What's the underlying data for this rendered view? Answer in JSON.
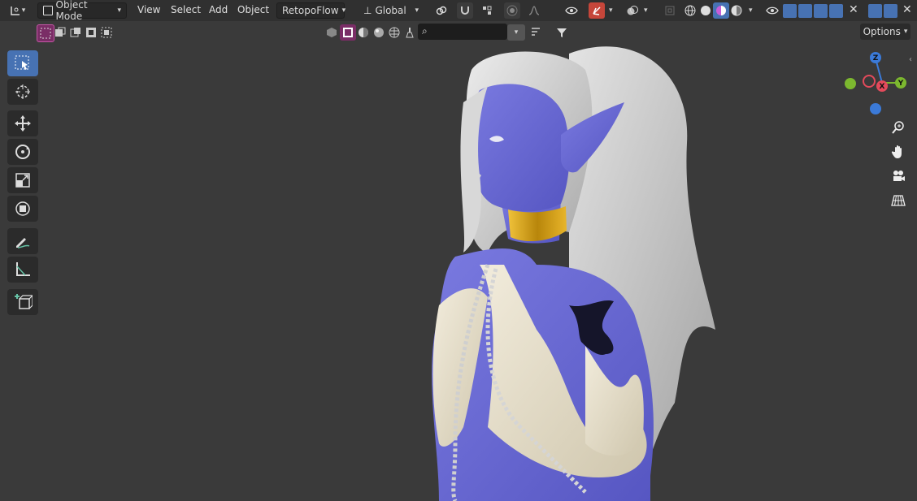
{
  "header": {
    "mode_label": "Object Mode",
    "menus": [
      "View",
      "Select",
      "Add",
      "Object"
    ],
    "addon_label": "RetopoFlow",
    "orientation_label": "Global"
  },
  "viewport": {
    "options_label": "Options",
    "search": {
      "placeholder": ""
    },
    "gizmo": {
      "x": "X",
      "y": "Y",
      "z": "Z"
    }
  },
  "colors": {
    "accent": "#4772b3",
    "skin": "#6f6fd6",
    "hair": "#dcdcdc",
    "gold": "#d8a21c",
    "gizmo_x": "#e34a5b",
    "gizmo_y": "#7cb82f",
    "gizmo_z": "#3b7ad8"
  },
  "icons": {
    "editor_type": "editor-type-icon",
    "select_box": "select-box-icon",
    "cursor": "cursor-icon",
    "move": "move-icon",
    "rotate": "rotate-icon",
    "scale": "scale-icon",
    "transform": "transform-icon",
    "annotate": "annotate-icon",
    "measure": "measure-icon",
    "add_cube": "add-cube-icon",
    "zoom": "zoom-icon",
    "pan": "hand-icon",
    "camera": "camera-icon",
    "grid": "grid-icon"
  }
}
